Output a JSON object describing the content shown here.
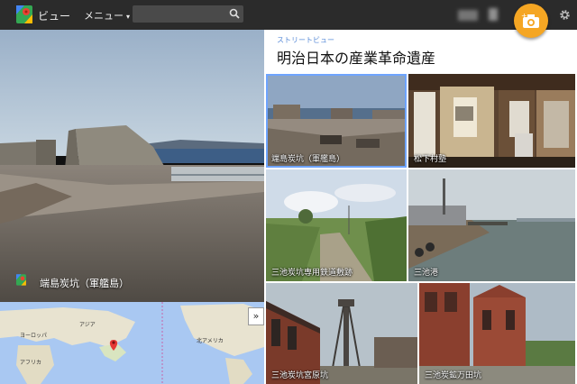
{
  "header": {
    "app_title": "ビュー",
    "menu_label": "メニュー",
    "search_placeholder": ""
  },
  "street_view": {
    "caption": "端島炭坑（軍艦島）"
  },
  "map": {
    "labels": [
      "アジア",
      "ヨーロッパ",
      "アフリカ",
      "北アメリカ"
    ]
  },
  "panel": {
    "kicker": "ストリートビュー",
    "title": "明治日本の産業革命遺産",
    "tiles": [
      {
        "caption": "端島炭坑（軍艦島）"
      },
      {
        "caption": "松下村塾"
      },
      {
        "caption": "三池炭坑専用鉄道敷跡"
      },
      {
        "caption": "三池港"
      },
      {
        "caption": "三池炭坑宮原坑"
      },
      {
        "caption": "三池炭鉱万田坑"
      }
    ]
  },
  "colors": {
    "topbar": "#2b2b2b",
    "accent_orange": "#f5a623",
    "kicker_blue": "#5b8dd8",
    "selected_outline": "#6ea4ff"
  }
}
